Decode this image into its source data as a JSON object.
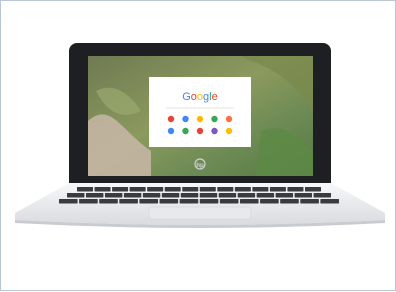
{
  "product": {
    "screen": {
      "search_logo": {
        "letters": [
          "G",
          "o",
          "o",
          "g",
          "l",
          "e"
        ],
        "colors": [
          "#4285f4",
          "#ea4335",
          "#fbbc05",
          "#4285f4",
          "#34a853",
          "#ea4335"
        ]
      },
      "app_icon_colors": [
        [
          "#ea4335",
          "#4285f4",
          "#fbbc05",
          "#34a853",
          "#ff7043"
        ],
        [
          "#4285f4",
          "#34a853",
          "#ea4335",
          "#7e57c2",
          "#fbbc05"
        ]
      ]
    },
    "brand_logo": "hp-logo-icon"
  },
  "colors": {
    "frame_border": "#b9c6d4",
    "bezel": "#1e1f22",
    "chassis": "#f2f3f5",
    "keys": "#3a3b3f"
  }
}
